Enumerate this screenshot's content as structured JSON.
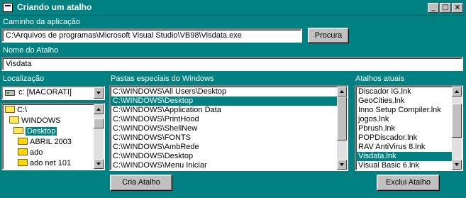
{
  "window": {
    "title": "Criando um atalho",
    "controls": {
      "minimize": "_",
      "maximize": "□",
      "close": "×"
    }
  },
  "app_path": {
    "label": "Caminho da aplicação",
    "value": "C:\\Arquivos de programas\\Microsoft Visual Studio\\VB98\\Visdata.exe",
    "browse_label": "Procura"
  },
  "shortcut_name": {
    "label": "Nome do Atalho",
    "value": "Visdata"
  },
  "location": {
    "label": "Localização",
    "drive": "c: [MACORATI]",
    "folders": [
      {
        "name": "C:\\",
        "icon": "open-folder-icon",
        "indent": 0,
        "selected": false
      },
      {
        "name": "WINDOWS",
        "icon": "open-folder-icon",
        "indent": 1,
        "selected": false
      },
      {
        "name": "Desktop",
        "icon": "open-folder-icon",
        "indent": 2,
        "selected": true
      },
      {
        "name": "ABRIL 2003",
        "icon": "folder-icon",
        "indent": 3,
        "selected": false
      },
      {
        "name": "ado",
        "icon": "folder-icon",
        "indent": 3,
        "selected": false
      },
      {
        "name": "ado net 101",
        "icon": "folder-icon",
        "indent": 3,
        "selected": false
      }
    ]
  },
  "special_folders": {
    "label": "Pastas especiais do Windows",
    "items": [
      "C:\\WINDOWS\\All Users\\Desktop",
      "C:\\WINDOWS\\Desktop",
      "C:\\WINDOWS\\Application Data",
      "C:\\WINDOWS\\PrintHood",
      "C:\\WINDOWS\\ShellNew",
      "C:\\WINDOWS\\FONTS",
      "C:\\WINDOWS\\AmbRede",
      "C:\\WINDOWS\\Desktop",
      "C:\\WINDOWS\\Menu Iniciar"
    ],
    "selected_index": 1
  },
  "current_shortcuts": {
    "label": "Atalhos atuais",
    "items": [
      "Discador iG.lnk",
      "GeoCities.lnk",
      "Inno Setup Compiler.lnk",
      "jogos.lnk",
      "Pbrush.lnk",
      "POPDiscador.lnk",
      "RAV AntiVirus 8.lnk",
      "Visdata.lnk",
      "Visual Basic 6.lnk"
    ],
    "selected_index": 7
  },
  "actions": {
    "create_label": "Cria Atalho",
    "delete_label": "Exclui Atalho"
  },
  "colors": {
    "window_bg": "#008080",
    "selection": "#008080",
    "button_face": "#c0c0c0"
  }
}
